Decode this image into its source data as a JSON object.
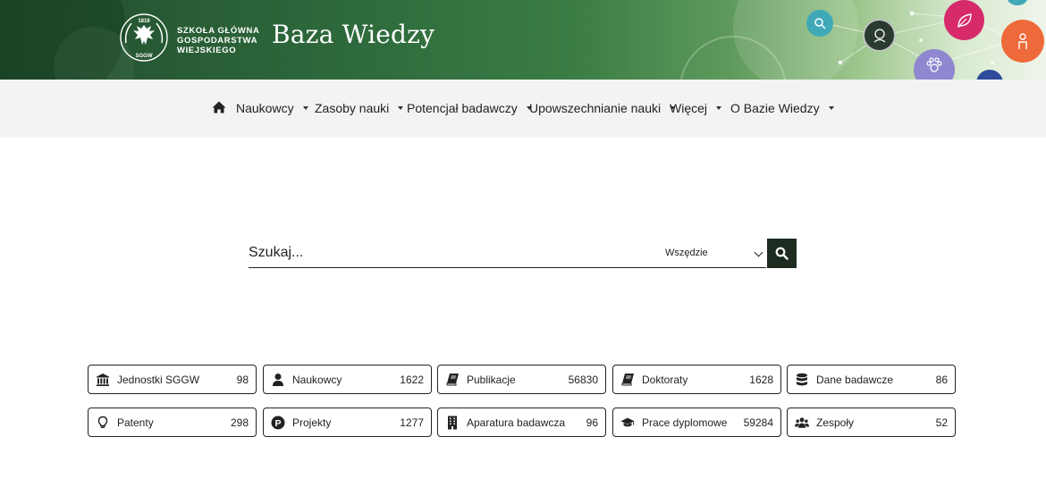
{
  "header": {
    "logo_lines": [
      "SZKOŁA GŁÓWNA",
      "GOSPODARSTWA",
      "WIEJSKIEGO"
    ],
    "logo_year": "1816",
    "logo_abbr": "SGGW",
    "title": "Baza Wiedzy"
  },
  "nav": {
    "home_icon": "home-icon",
    "items": [
      {
        "label": "Naukowcy"
      },
      {
        "label": "Zasoby nauki"
      },
      {
        "label": "Potencjał badawczy"
      },
      {
        "label": "Upowszechnianie nauki"
      },
      {
        "label": "Więcej"
      },
      {
        "label": "O Bazie Wiedzy"
      }
    ]
  },
  "search": {
    "placeholder": "Szukaj...",
    "value": "",
    "scope_selected": "Wszędzie",
    "button_icon": "search-icon"
  },
  "tiles": [
    {
      "label": "Jednostki SGGW",
      "count": "98",
      "icon": "institution-icon"
    },
    {
      "label": "Naukowcy",
      "count": "1622",
      "icon": "user-icon"
    },
    {
      "label": "Publikacje",
      "count": "56830",
      "icon": "book-icon"
    },
    {
      "label": "Doktoraty",
      "count": "1628",
      "icon": "book-icon"
    },
    {
      "label": "Dane badawcze",
      "count": "86",
      "icon": "database-icon"
    },
    {
      "label": "Patenty",
      "count": "298",
      "icon": "lightbulb-icon"
    },
    {
      "label": "Projekty",
      "count": "1277",
      "icon": "project-p-icon"
    },
    {
      "label": "Aparatura badawcza",
      "count": "96",
      "icon": "building-icon"
    },
    {
      "label": "Prace dyplomowe",
      "count": "59284",
      "icon": "graduation-cap-icon"
    },
    {
      "label": "Zespoły",
      "count": "52",
      "icon": "users-icon"
    }
  ],
  "colors": {
    "banner_dark": "#1f4a2c",
    "banner_mid": "#3b7d45",
    "nav_bg": "#f3f3f3",
    "search_button": "#1d2b21"
  }
}
